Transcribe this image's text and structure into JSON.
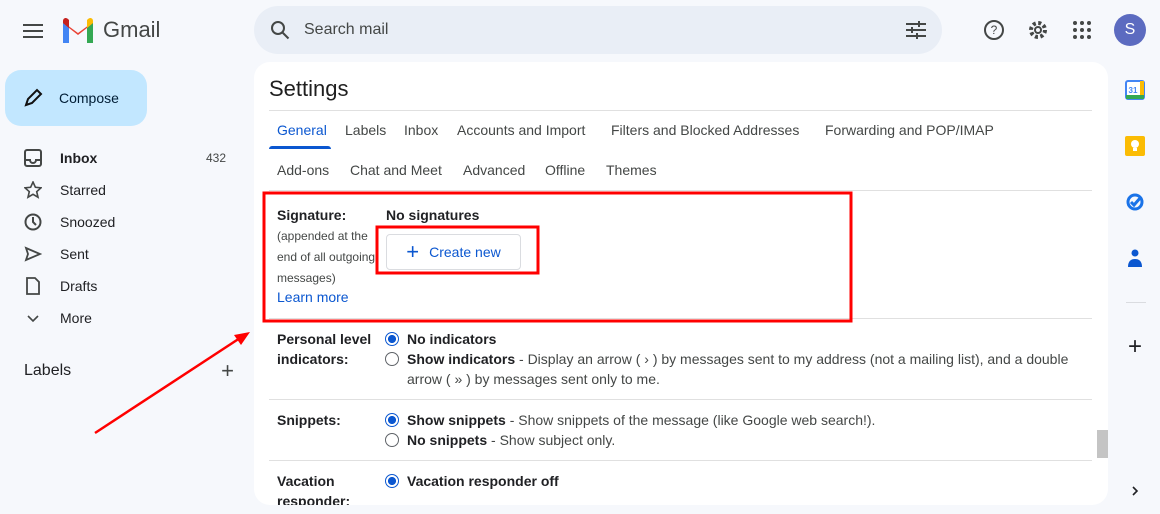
{
  "header": {
    "app_name": "Gmail",
    "search_placeholder": "Search mail",
    "avatar_letter": "S"
  },
  "sidebar": {
    "compose": "Compose",
    "items": [
      {
        "label": "Inbox",
        "count": "432",
        "icon": "inbox-icon"
      },
      {
        "label": "Starred",
        "icon": "star-icon"
      },
      {
        "label": "Snoozed",
        "icon": "clock-icon"
      },
      {
        "label": "Sent",
        "icon": "send-icon"
      },
      {
        "label": "Drafts",
        "icon": "draft-icon"
      },
      {
        "label": "More",
        "icon": "chevron-down-icon"
      }
    ],
    "labels_heading": "Labels"
  },
  "settings": {
    "title": "Settings",
    "tabs": [
      "General",
      "Labels",
      "Inbox",
      "Accounts and Import",
      "Filters and Blocked Addresses",
      "Forwarding and POP/IMAP",
      "Add-ons",
      "Chat and Meet",
      "Advanced",
      "Offline",
      "Themes"
    ],
    "active_tab": "General",
    "signature": {
      "label": "Signature:",
      "desc1": "(appended at the",
      "desc2": "end of all outgoing",
      "desc3": "messages)",
      "learn_more": "Learn more",
      "none": "No signatures",
      "create": "Create new"
    },
    "indicators": {
      "label1": "Personal level",
      "label2": "indicators:",
      "opt1": "No indicators",
      "opt2": "Show indicators",
      "opt2_desc": "- Display an arrow ( › ) by messages sent to my address (not a mailing list), and a double",
      "opt2_desc2": "arrow ( » ) by messages sent only to me."
    },
    "snippets": {
      "label": "Snippets:",
      "opt1": "Show snippets",
      "opt1_desc": "- Show snippets of the message (like Google web search!).",
      "opt2": "No snippets",
      "opt2_desc": "- Show subject only."
    },
    "vacation": {
      "label1": "Vacation",
      "label2": "responder:",
      "opt1": "Vacation responder off"
    }
  },
  "colors": {
    "accent": "#0b57d0",
    "compose_bg": "#c2e7ff",
    "annotation": "#ff0000"
  }
}
